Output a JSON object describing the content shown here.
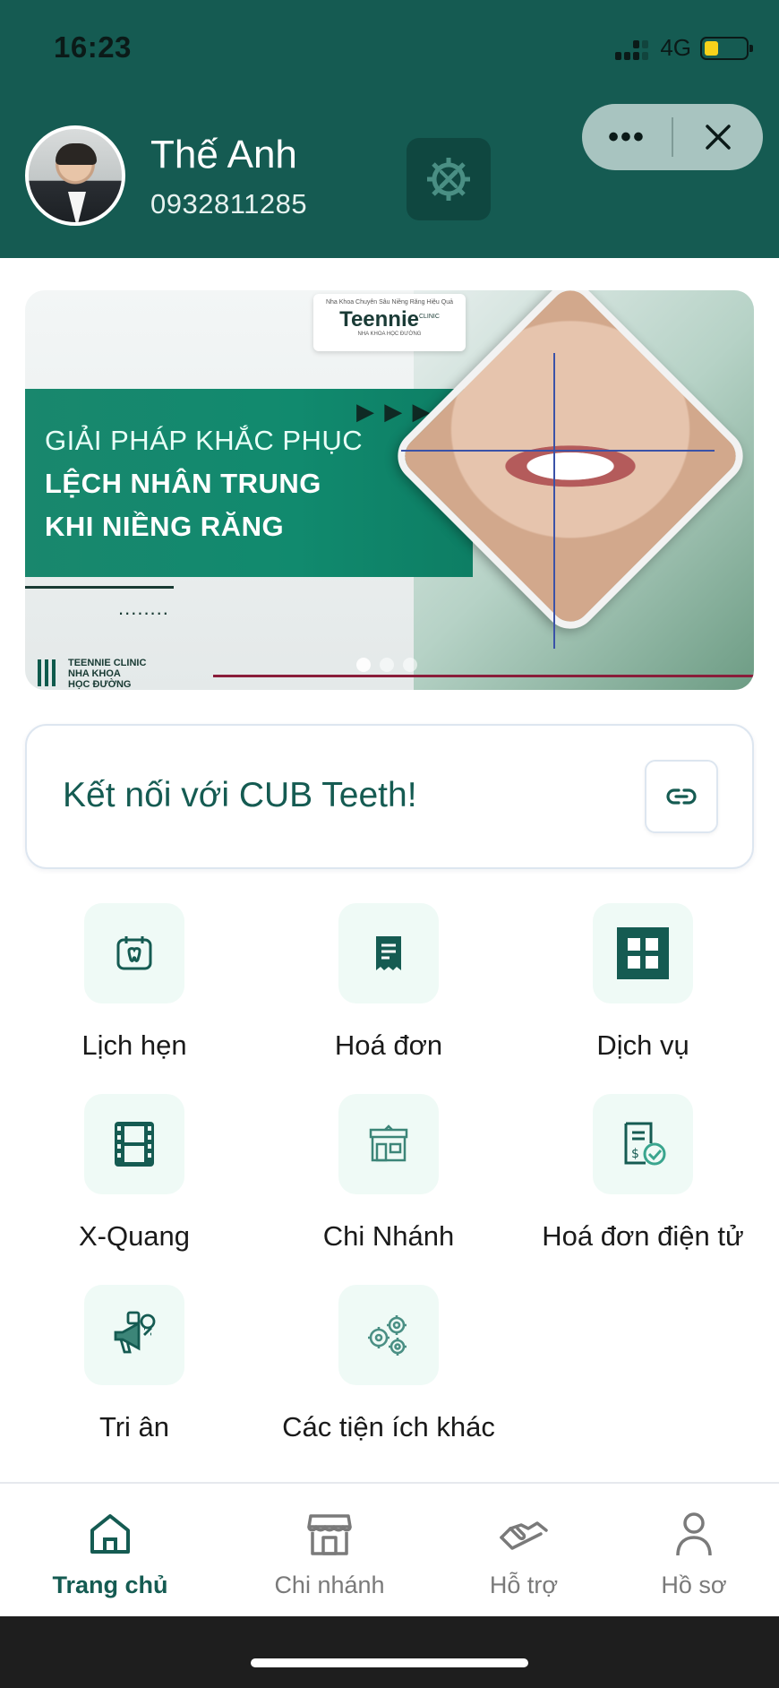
{
  "status_bar": {
    "time": "16:23",
    "network": "4G",
    "battery_level": 0.35,
    "battery_color": "#f7d21b"
  },
  "header": {
    "user_name": "Thế Anh",
    "phone": "0932811285",
    "settings_icon": "gear-wrench-icon",
    "capsule": {
      "more_icon": "more-dots-icon",
      "close_icon": "close-icon"
    },
    "background_color": "#155b52"
  },
  "banner": {
    "logo_tagline": "Nha Khoa Chuyên Sâu Niềng Răng Hiệu Quả",
    "logo_brand": "Teennie",
    "logo_brand_sup": "CLINIC",
    "logo_sub": "NHA KHOA HỌC ĐƯỜNG",
    "line1": "GIẢI PHÁP KHẮC PHỤC",
    "line2": "LỆCH NHÂN TRUNG",
    "line3": "KHI NIỀNG RĂNG",
    "footer_line1": "TEENNIE CLINIC",
    "footer_line2": "NHA KHOA",
    "footer_line3": "HỌC ĐƯỜNG",
    "slide_count": 3,
    "active_slide": 1
  },
  "connect_card": {
    "text": "Kết nối với CUB Teeth!",
    "icon": "link-icon"
  },
  "grid": [
    {
      "label": "Lịch hẹn",
      "icon": "calendar-tooth-icon"
    },
    {
      "label": "Hoá đơn",
      "icon": "receipt-icon"
    },
    {
      "label": "Dịch vụ",
      "icon": "grid-squares-icon"
    },
    {
      "label": "X-Quang",
      "icon": "film-strip-icon"
    },
    {
      "label": "Chi Nhánh",
      "icon": "store-icon"
    },
    {
      "label": "Hoá đơn điện tử",
      "icon": "e-invoice-icon"
    },
    {
      "label": "Tri ân",
      "icon": "megaphone-icon"
    },
    {
      "label": "Các tiện ích khác",
      "icon": "gears-icon"
    }
  ],
  "bottom_nav": [
    {
      "label": "Trang chủ",
      "icon": "home-icon",
      "active": true
    },
    {
      "label": "Chi nhánh",
      "icon": "store-icon",
      "active": false
    },
    {
      "label": "Hỗ trợ",
      "icon": "handshake-icon",
      "active": false
    },
    {
      "label": "Hồ sơ",
      "icon": "user-icon",
      "active": false
    }
  ],
  "colors": {
    "accent": "#155b52",
    "accent_light_bg": "#effaf6",
    "inactive": "#7a7a7a"
  }
}
